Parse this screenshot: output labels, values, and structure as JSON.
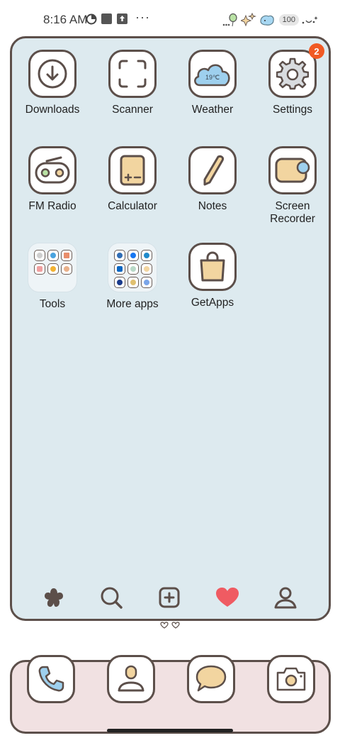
{
  "status_bar": {
    "time": "8:16 AM",
    "battery": "100",
    "more": "···"
  },
  "apps": [
    {
      "label": "Downloads",
      "icon": "download-icon"
    },
    {
      "label": "Scanner",
      "icon": "scanner-icon"
    },
    {
      "label": "Weather",
      "icon": "weather-cloud-icon",
      "temperature": "19℃"
    },
    {
      "label": "Settings",
      "icon": "gear-icon",
      "badge": "2"
    },
    {
      "label": "FM Radio",
      "icon": "radio-icon"
    },
    {
      "label": "Calculator",
      "icon": "calculator-icon",
      "symbols": "+ −"
    },
    {
      "label": "Notes",
      "icon": "pencil-icon"
    },
    {
      "label": "Screen\nRecorder",
      "icon": "screen-recorder-icon"
    },
    {
      "label": "Tools",
      "icon": "folder-icon"
    },
    {
      "label": "More apps",
      "icon": "folder-icon"
    },
    {
      "label": "GetApps",
      "icon": "shopping-bag-icon"
    }
  ],
  "bottom_nav": [
    "home-flower-icon",
    "search-icon",
    "add-icon",
    "heart-icon",
    "profile-icon"
  ],
  "dock": [
    "phone-icon",
    "contacts-icon",
    "messages-icon",
    "camera-icon"
  ],
  "colors": {
    "panel": "#ddeaef",
    "dock": "#f1e1e2",
    "outline": "#5c4f4a",
    "badge": "#f15a24",
    "accent_tan": "#f2d5a0",
    "accent_blue": "#9ed0ee",
    "heart": "#ef5b62"
  }
}
